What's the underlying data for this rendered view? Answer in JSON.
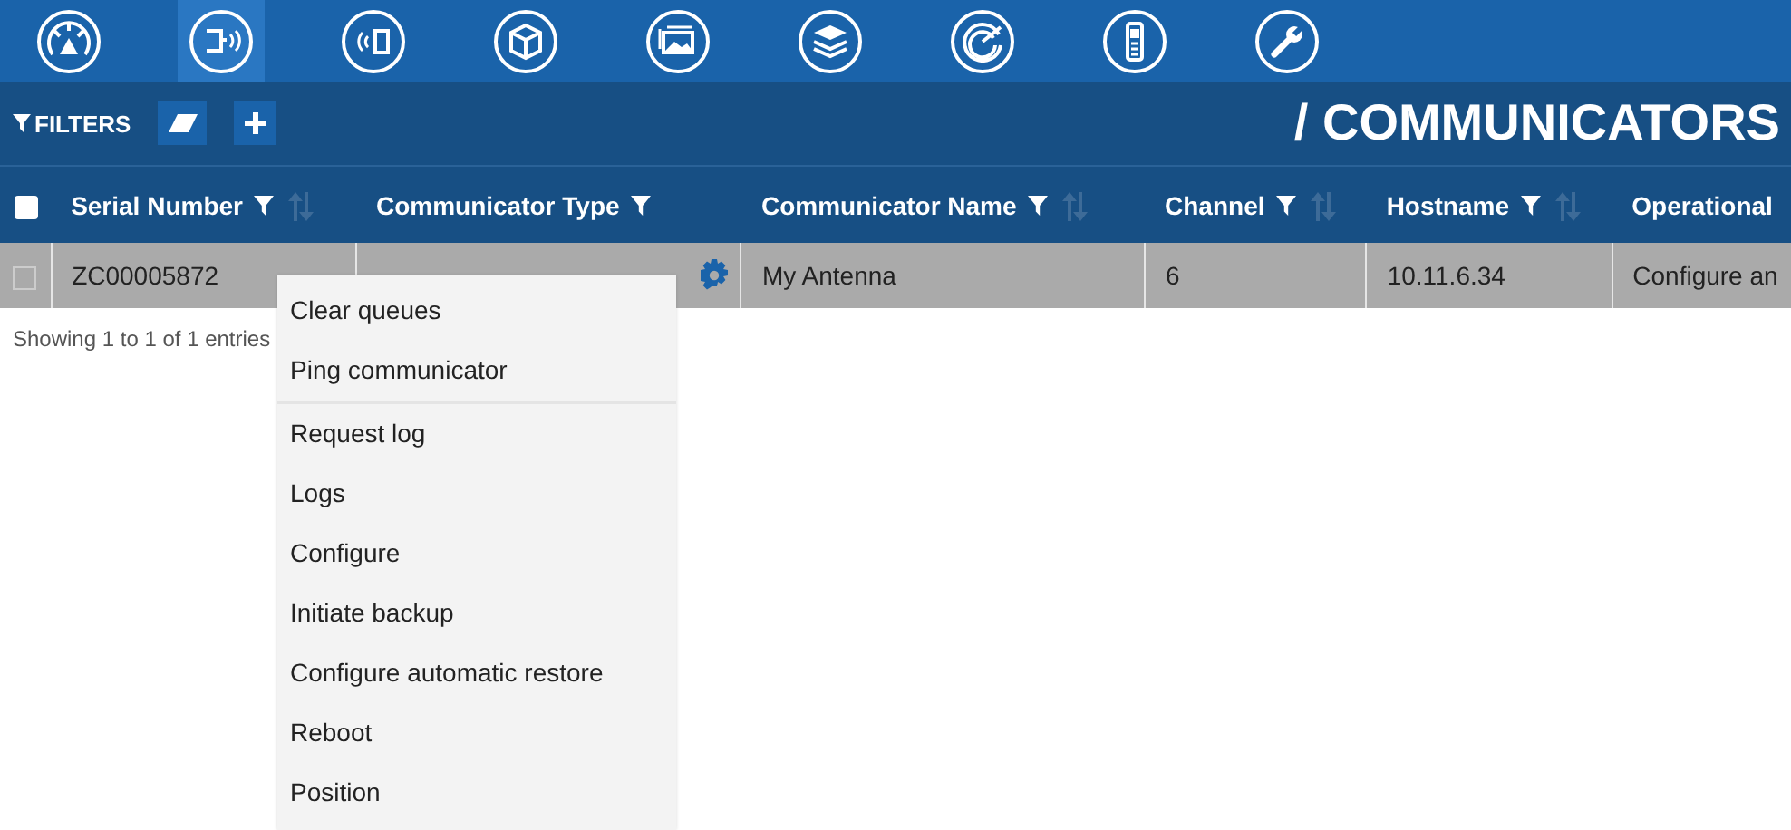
{
  "nav": [
    {
      "selected": false
    },
    {
      "selected": true
    },
    {
      "selected": false
    },
    {
      "selected": false
    },
    {
      "selected": false
    },
    {
      "selected": false
    },
    {
      "selected": false
    },
    {
      "selected": false
    },
    {
      "selected": false
    }
  ],
  "filter_bar": {
    "label": "FILTERS",
    "title": "/ COMMUNICATORS"
  },
  "table": {
    "columns": [
      {
        "label": "Serial Number",
        "filterable": true,
        "sortable": true
      },
      {
        "label": "Communicator Type",
        "filterable": true,
        "sortable": false
      },
      {
        "label": "Communicator Name",
        "filterable": true,
        "sortable": true
      },
      {
        "label": "Channel",
        "filterable": true,
        "sortable": true
      },
      {
        "label": "Hostname",
        "filterable": true,
        "sortable": true
      },
      {
        "label": "Operational",
        "filterable": false,
        "sortable": false
      }
    ],
    "select_all": {
      "checked": false
    },
    "rows": [
      {
        "checked": false,
        "serial_number": "ZC00005872",
        "communicator_name": "My Antenna",
        "channel": "6",
        "hostname": "10.11.6.34",
        "operational": "Configure an"
      }
    ],
    "info": "Showing 1 to 1 of 1 entries"
  },
  "context_menu": [
    {
      "label": "Clear queues",
      "separator_after": false
    },
    {
      "label": "Ping communicator",
      "separator_after": true
    },
    {
      "label": "Request log",
      "separator_after": false
    },
    {
      "label": "Logs",
      "separator_after": false
    },
    {
      "label": "Configure",
      "separator_after": false
    },
    {
      "label": "Initiate backup",
      "separator_after": false
    },
    {
      "label": "Configure automatic restore",
      "separator_after": false
    },
    {
      "label": "Reboot",
      "separator_after": false
    },
    {
      "label": "Position",
      "separator_after": false
    }
  ]
}
